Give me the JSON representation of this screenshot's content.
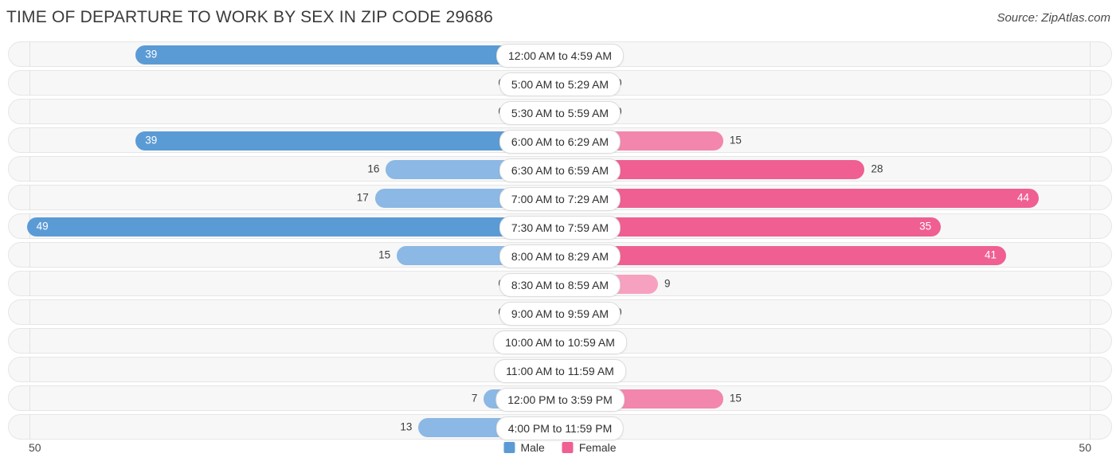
{
  "header": {
    "title": "TIME OF DEPARTURE TO WORK BY SEX IN ZIP CODE 29686",
    "source": "Source: ZipAtlas.com"
  },
  "legend": {
    "male_label": "Male",
    "female_label": "Female",
    "male_color": "#5b9bd5",
    "female_color": "#ef5f92"
  },
  "axis": {
    "left_max": "50",
    "right_max": "50"
  },
  "chart_data": {
    "type": "bar",
    "title": "TIME OF DEPARTURE TO WORK BY SEX IN ZIP CODE 29686",
    "subtitle": "Source: ZipAtlas.com",
    "orientation": "horizontal-diverging",
    "xlabel": "",
    "ylabel": "",
    "xlim": [
      -50,
      50
    ],
    "axis_max": 50,
    "grid": false,
    "legend_position": "bottom-center",
    "categories": [
      "12:00 AM to 4:59 AM",
      "5:00 AM to 5:29 AM",
      "5:30 AM to 5:59 AM",
      "6:00 AM to 6:29 AM",
      "6:30 AM to 6:59 AM",
      "7:00 AM to 7:29 AM",
      "7:30 AM to 7:59 AM",
      "8:00 AM to 8:29 AM",
      "8:30 AM to 8:59 AM",
      "9:00 AM to 9:59 AM",
      "10:00 AM to 10:59 AM",
      "11:00 AM to 11:59 AM",
      "12:00 PM to 3:59 PM",
      "4:00 PM to 11:59 PM"
    ],
    "series": [
      {
        "name": "Male",
        "color": "#5b9bd5",
        "side": "left",
        "values": [
          39,
          0,
          0,
          39,
          16,
          17,
          49,
          15,
          0,
          0,
          0,
          0,
          7,
          13
        ]
      },
      {
        "name": "Female",
        "color": "#ef5f92",
        "side": "right",
        "values": [
          0,
          0,
          0,
          15,
          28,
          44,
          35,
          41,
          9,
          0,
          0,
          0,
          15,
          0
        ]
      }
    ]
  },
  "rows": [
    {
      "label": "12:00 AM to 4:59 AM",
      "male": 39,
      "male_text": "39",
      "female": 0,
      "female_text": "0"
    },
    {
      "label": "5:00 AM to 5:29 AM",
      "male": 0,
      "male_text": "0",
      "female": 0,
      "female_text": "0"
    },
    {
      "label": "5:30 AM to 5:59 AM",
      "male": 0,
      "male_text": "0",
      "female": 0,
      "female_text": "0"
    },
    {
      "label": "6:00 AM to 6:29 AM",
      "male": 39,
      "male_text": "39",
      "female": 15,
      "female_text": "15"
    },
    {
      "label": "6:30 AM to 6:59 AM",
      "male": 16,
      "male_text": "16",
      "female": 28,
      "female_text": "28"
    },
    {
      "label": "7:00 AM to 7:29 AM",
      "male": 17,
      "male_text": "17",
      "female": 44,
      "female_text": "44"
    },
    {
      "label": "7:30 AM to 7:59 AM",
      "male": 49,
      "male_text": "49",
      "female": 35,
      "female_text": "35"
    },
    {
      "label": "8:00 AM to 8:29 AM",
      "male": 15,
      "male_text": "15",
      "female": 41,
      "female_text": "41"
    },
    {
      "label": "8:30 AM to 8:59 AM",
      "male": 0,
      "male_text": "0",
      "female": 9,
      "female_text": "9"
    },
    {
      "label": "9:00 AM to 9:59 AM",
      "male": 0,
      "male_text": "0",
      "female": 0,
      "female_text": "0"
    },
    {
      "label": "10:00 AM to 10:59 AM",
      "male": 0,
      "male_text": "0",
      "female": 0,
      "female_text": "0"
    },
    {
      "label": "11:00 AM to 11:59 AM",
      "male": 0,
      "male_text": "0",
      "female": 0,
      "female_text": "0"
    },
    {
      "label": "12:00 PM to 3:59 PM",
      "male": 7,
      "male_text": "7",
      "female": 15,
      "female_text": "15"
    },
    {
      "label": "4:00 PM to 11:59 PM",
      "male": 13,
      "male_text": "13",
      "female": 0,
      "female_text": "0"
    }
  ]
}
